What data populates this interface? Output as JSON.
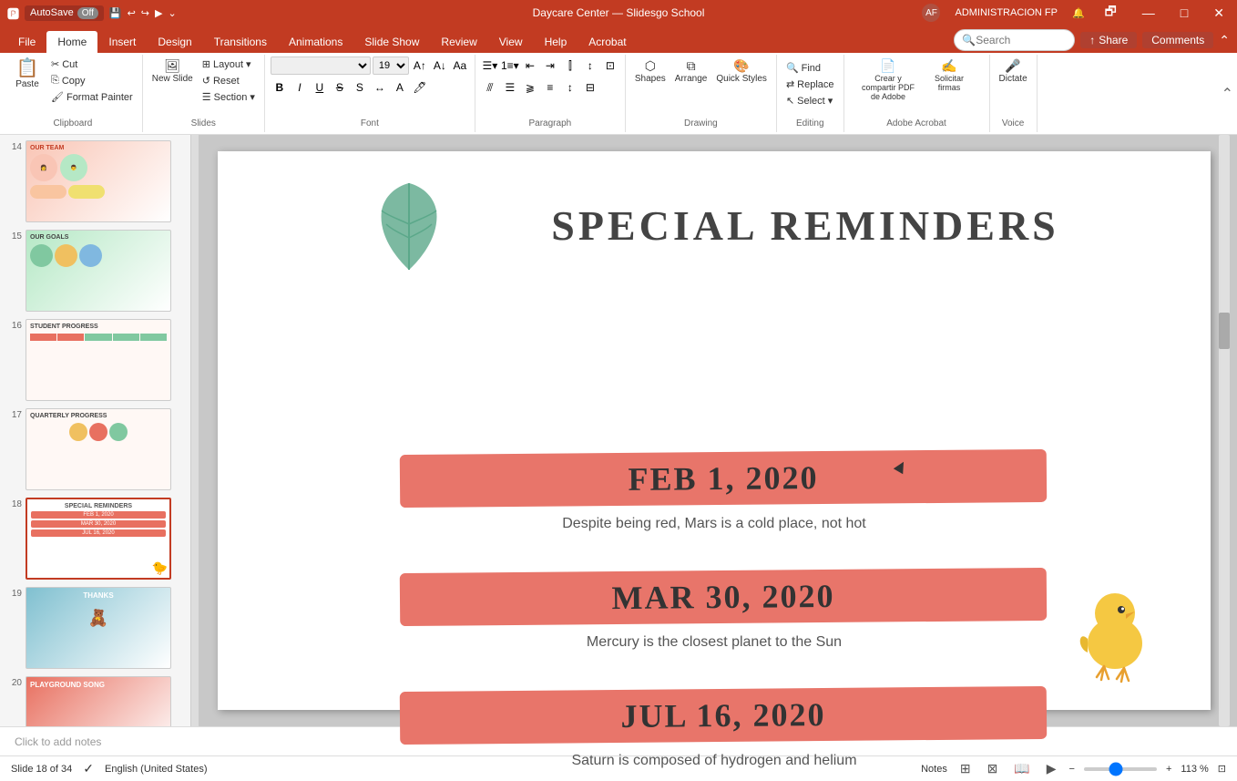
{
  "titleBar": {
    "autosave": "AutoSave",
    "autosave_state": "Off",
    "title": "Daycare Center — Slidesgo School",
    "user": "ADMINISTRACION FP",
    "user_initials": "AF"
  },
  "ribbonTabs": [
    {
      "label": "File",
      "active": false
    },
    {
      "label": "Home",
      "active": true
    },
    {
      "label": "Insert",
      "active": false
    },
    {
      "label": "Design",
      "active": false
    },
    {
      "label": "Transitions",
      "active": false
    },
    {
      "label": "Animations",
      "active": false
    },
    {
      "label": "Slide Show",
      "active": false
    },
    {
      "label": "Review",
      "active": false
    },
    {
      "label": "View",
      "active": false
    },
    {
      "label": "Help",
      "active": false
    },
    {
      "label": "Acrobat",
      "active": false
    }
  ],
  "ribbonGroups": {
    "clipboard": {
      "label": "Clipboard",
      "paste": "Paste",
      "cut": "Cut",
      "copy": "Copy",
      "format_painter": "Format Painter"
    },
    "slides": {
      "label": "Slides",
      "new_slide": "New Slide",
      "layout": "Layout",
      "reset": "Reset",
      "section": "Section"
    },
    "font": {
      "label": "Font",
      "font_name": "",
      "font_size": "19",
      "bold": "B",
      "italic": "I",
      "underline": "U",
      "strikethrough": "S",
      "shadow": "S",
      "increase": "A",
      "decrease": "A",
      "clear": "A"
    },
    "paragraph": {
      "label": "Paragraph"
    },
    "drawing": {
      "label": "Drawing",
      "shapes": "Shapes",
      "arrange": "Arrange",
      "quick_styles": "Quick Styles"
    },
    "editing": {
      "label": "Editing",
      "find": "Find",
      "replace": "Replace",
      "select": "Select"
    },
    "adobe": {
      "label": "Adobe Acrobat",
      "create": "Crear y compartir PDF de Adobe",
      "request": "Solicitar firmas"
    },
    "voice": {
      "label": "Voice",
      "dictate": "Dictate"
    }
  },
  "search": {
    "placeholder": "Search",
    "value": ""
  },
  "share": {
    "label": "Share",
    "comments": "Comments"
  },
  "slidePanel": {
    "slides": [
      {
        "num": "14",
        "active": false,
        "theme": "team"
      },
      {
        "num": "15",
        "active": false,
        "theme": "goals"
      },
      {
        "num": "16",
        "active": false,
        "theme": "progress"
      },
      {
        "num": "17",
        "active": false,
        "theme": "progress2"
      },
      {
        "num": "18",
        "active": true,
        "theme": "reminders"
      },
      {
        "num": "19",
        "active": false,
        "theme": "thanks"
      },
      {
        "num": "20",
        "active": false,
        "theme": "song"
      }
    ]
  },
  "slide": {
    "title": "SPECIAL REMINDERS",
    "dates": [
      {
        "date": "FEB 1, 2020",
        "description": "Despite being red, Mars is a cold place, not hot"
      },
      {
        "date": "MAR 30, 2020",
        "description": "Mercury is the closest planet to the Sun"
      },
      {
        "date": "JUL 16, 2020",
        "description": "Saturn is composed of hydrogen and helium"
      }
    ]
  },
  "notes": {
    "placeholder": "Click to add notes"
  },
  "statusBar": {
    "slide_info": "Slide 18 of 34",
    "spell_check": "English (United States)",
    "notes_label": "Notes",
    "zoom": "113 %"
  }
}
